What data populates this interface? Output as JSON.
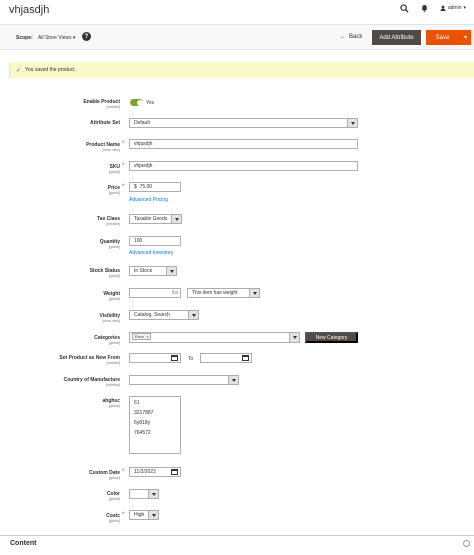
{
  "header": {
    "page_title": "vhjasdjh",
    "user_name": "admin"
  },
  "actions": {
    "scope_label": "Scope:",
    "scope_value": "All Store Views",
    "help_glyph": "?",
    "back_label": "Back",
    "add_attribute_label": "Add Attribute",
    "save_label": "Save"
  },
  "message": {
    "success_text": "You saved the product."
  },
  "form": {
    "enable_product": {
      "label": "Enable Product",
      "scope": "[website]",
      "value_text": "Yes",
      "enabled": true
    },
    "attribute_set": {
      "label": "Attribute Set",
      "value": "Default"
    },
    "product_name": {
      "label": "Product Name",
      "scope": "[store view]",
      "value": "vhjasdjh"
    },
    "sku": {
      "label": "SKU",
      "scope": "[global]",
      "value": "vhjasdjh"
    },
    "price": {
      "label": "Price",
      "scope": "[global]",
      "currency": "$",
      "value": "75.00",
      "link": "Advanced Pricing"
    },
    "tax_class": {
      "label": "Tax Class",
      "scope": "[website]",
      "value": "Taxable Goods"
    },
    "quantity": {
      "label": "Quantity",
      "scope": "[global]",
      "value": "100",
      "link": "Advanced Inventory"
    },
    "stock_status": {
      "label": "Stock Status",
      "scope": "[global]",
      "value": "In Stock"
    },
    "weight": {
      "label": "Weight",
      "scope": "[global]",
      "value": "",
      "unit": "lbs",
      "type_value": "This item has weight"
    },
    "visibility": {
      "label": "Visibility",
      "scope": "[store view]",
      "value": "Catalog, Search"
    },
    "categories": {
      "label": "Categories",
      "scope": "[global]",
      "chip": "Error",
      "new_category_label": "New Category"
    },
    "new_from": {
      "label": "Set Product as New From",
      "scope": "[website]",
      "from_value": "",
      "to_label": "To",
      "to_value": ""
    },
    "country": {
      "label": "Country of Manufacture",
      "scope": "[website]",
      "value": ""
    },
    "ahghsc": {
      "label": "ahghsc",
      "scope": "[global]",
      "options": [
        "61",
        "3217887",
        "6y818y",
        "764572"
      ]
    },
    "custom_date": {
      "label": "Custom Date",
      "scope": "[global]",
      "value": "11/2/2022"
    },
    "color": {
      "label": "Color",
      "scope": "[global]",
      "value": ""
    },
    "costc": {
      "label": "Costc",
      "scope": "[global]",
      "value": "High"
    }
  },
  "content_section": {
    "title": "Content"
  },
  "colors": {
    "accent_orange": "#eb5202",
    "dark_button": "#514943",
    "toggle_green": "#79a22e",
    "link_blue": "#007bdb",
    "required_red": "#e02b27",
    "success_bg": "#fafac8"
  }
}
